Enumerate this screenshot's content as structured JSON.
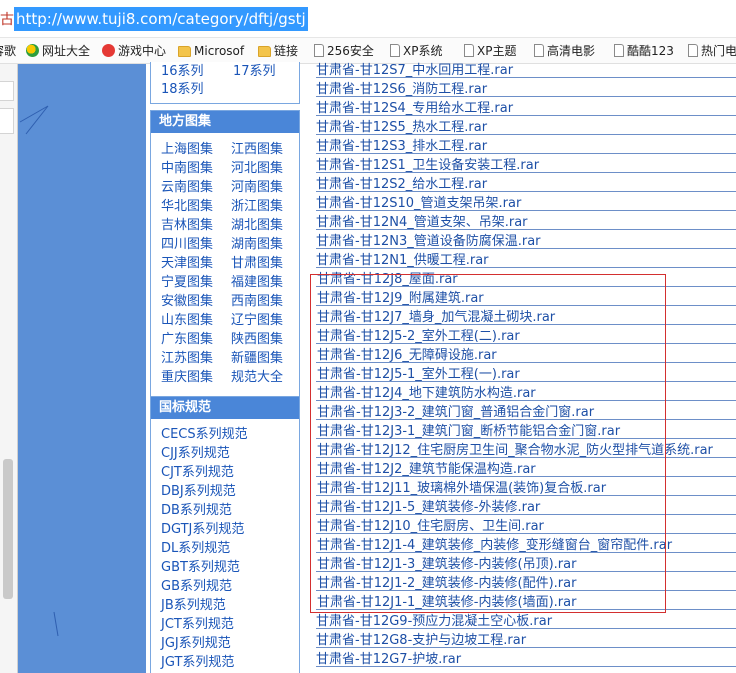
{
  "address_bar": {
    "side_label": "古",
    "url": "http://www.tuji8.com/category/dftj/gstj"
  },
  "bookmarks": [
    {
      "label": "容歌",
      "icon": "none"
    },
    {
      "label": "网址大全",
      "icon": "ie-icon"
    },
    {
      "label": "游戏中心",
      "icon": "game-icon"
    },
    {
      "label": "Microsof",
      "icon": "folder-icon"
    },
    {
      "label": "链接",
      "icon": "folder-icon"
    },
    {
      "label": "256安全",
      "icon": "page-icon"
    },
    {
      "label": "XP系统",
      "icon": "page-icon"
    },
    {
      "label": "XP主题",
      "icon": "page-icon"
    },
    {
      "label": "高清电影",
      "icon": "page-icon"
    },
    {
      "label": "酷酷123",
      "icon": "page-icon"
    },
    {
      "label": "热门电",
      "icon": "page-icon"
    }
  ],
  "series_box": {
    "items": [
      "16系列",
      "17系列",
      "18系列"
    ]
  },
  "local_atlas": {
    "title": "地方图集",
    "items": [
      "上海图集",
      "江西图集",
      "中南图集",
      "河北图集",
      "云南图集",
      "河南图集",
      "华北图集",
      "浙江图集",
      "吉林图集",
      "湖北图集",
      "四川图集",
      "湖南图集",
      "天津图集",
      "甘肃图集",
      "宁夏图集",
      "福建图集",
      "安徽图集",
      "西南图集",
      "山东图集",
      "辽宁图集",
      "广东图集",
      "陕西图集",
      "江苏图集",
      "新疆图集",
      "重庆图集",
      "规范大全"
    ]
  },
  "national_standards": {
    "title": "国标规范",
    "items": [
      "CECS系列规范",
      "CJJ系列规范",
      "CJT系列规范",
      "DBJ系列规范",
      "DB系列规范",
      "DGTJ系列规范",
      "DL系列规范",
      "GBT系列规范",
      "GB系列规范",
      "JB系列规范",
      "JCT系列规范",
      "JGJ系列规范",
      "JGT系列规范"
    ]
  },
  "files": [
    "甘肃省-甘12S7_中水回用工程.rar",
    "甘肃省-甘12S6_消防工程.rar",
    "甘肃省-甘12S4_专用给水工程.rar",
    "甘肃省-甘12S5_热水工程.rar",
    "甘肃省-甘12S3_排水工程.rar",
    "甘肃省-甘12S1_卫生设备安装工程.rar",
    "甘肃省-甘12S2_给水工程.rar",
    "甘肃省-甘12S10_管道支架吊架.rar",
    "甘肃省-甘12N4_管道支架、吊架.rar",
    "甘肃省-甘12N3_管道设备防腐保温.rar",
    "甘肃省-甘12N1_供暖工程.rar",
    "甘肃省-甘12J8_屋面.rar",
    "甘肃省-甘12J9_附属建筑.rar",
    "甘肃省-甘12J7_墙身_加气混凝土砌块.rar",
    "甘肃省-甘12J5-2_室外工程(二).rar",
    "甘肃省-甘12J6_无障碍设施.rar",
    "甘肃省-甘12J5-1_室外工程(一).rar",
    "甘肃省-甘12J4_地下建筑防水构造.rar",
    "甘肃省-甘12J3-2_建筑门窗_普通铝合金门窗.rar",
    "甘肃省-甘12J3-1_建筑门窗_断桥节能铝合金门窗.rar",
    "甘肃省-甘12J12_住宅厨房卫生间_聚合物水泥_防火型排气道系统.rar",
    "甘肃省-甘12J2_建筑节能保温构造.rar",
    "甘肃省-甘12J11_玻璃棉外墙保温(装饰)复合板.rar",
    "甘肃省-甘12J1-5_建筑装修-外装修.rar",
    "甘肃省-甘12J10_住宅厨房、卫生间.rar",
    "甘肃省-甘12J1-4_建筑装修_内装修_变形缝窗台_窗帘配件.rar",
    "甘肃省-甘12J1-3_建筑装修-内装修(吊顶).rar",
    "甘肃省-甘12J1-2_建筑装修-内装修(配件).rar",
    "甘肃省-甘12J1-1_建筑装修-内装修(墙面).rar",
    "甘肃省-甘12G9-预应力混凝土空心板.rar",
    "甘肃省-甘12G8-支护与边坡工程.rar",
    "甘肃省-甘12G7-护坡.rar"
  ],
  "colors": {
    "url_highlight": "#3399ff",
    "link": "#1d4fa6",
    "panel_title_bg": "#4a86d8",
    "band": "#5b8fd6",
    "selection_box": "#d32f2f"
  }
}
